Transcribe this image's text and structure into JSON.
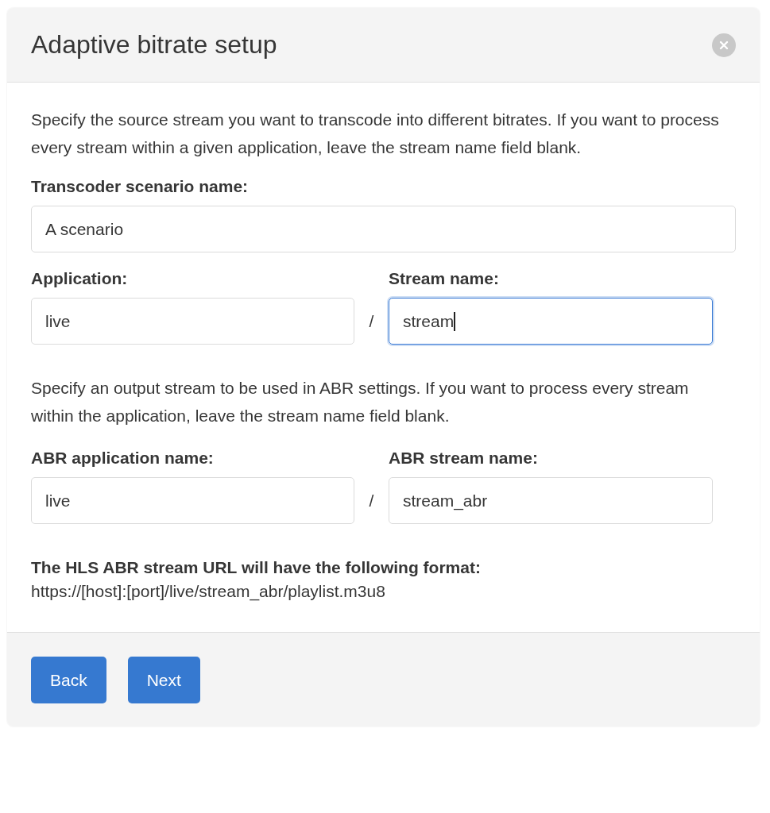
{
  "dialog": {
    "title": "Adaptive bitrate setup"
  },
  "source": {
    "description": "Specify the source stream you want to transcode into different bitrates. If you want to process every stream within a given application, leave the stream name field blank.",
    "scenario": {
      "label": "Transcoder scenario name:",
      "value": "A scenario",
      "focused": false
    },
    "application": {
      "label": "Application:",
      "value": "live",
      "focused": false
    },
    "separator": "/",
    "stream": {
      "label": "Stream name:",
      "value": "stream",
      "focused": true
    }
  },
  "output": {
    "description": "Specify an output stream to be used in ABR settings. If you want to process every stream within the application, leave the stream name field blank.",
    "application": {
      "label": "ABR application name:",
      "value": "live",
      "focused": false
    },
    "separator": "/",
    "stream": {
      "label": "ABR stream name:",
      "value": "stream_abr",
      "focused": false
    }
  },
  "url_format": {
    "heading": "The HLS ABR stream URL will have the following format:",
    "url": "https://[host]:[port]/live/stream_abr/playlist.m3u8"
  },
  "buttons": [
    "Back",
    "Next"
  ]
}
